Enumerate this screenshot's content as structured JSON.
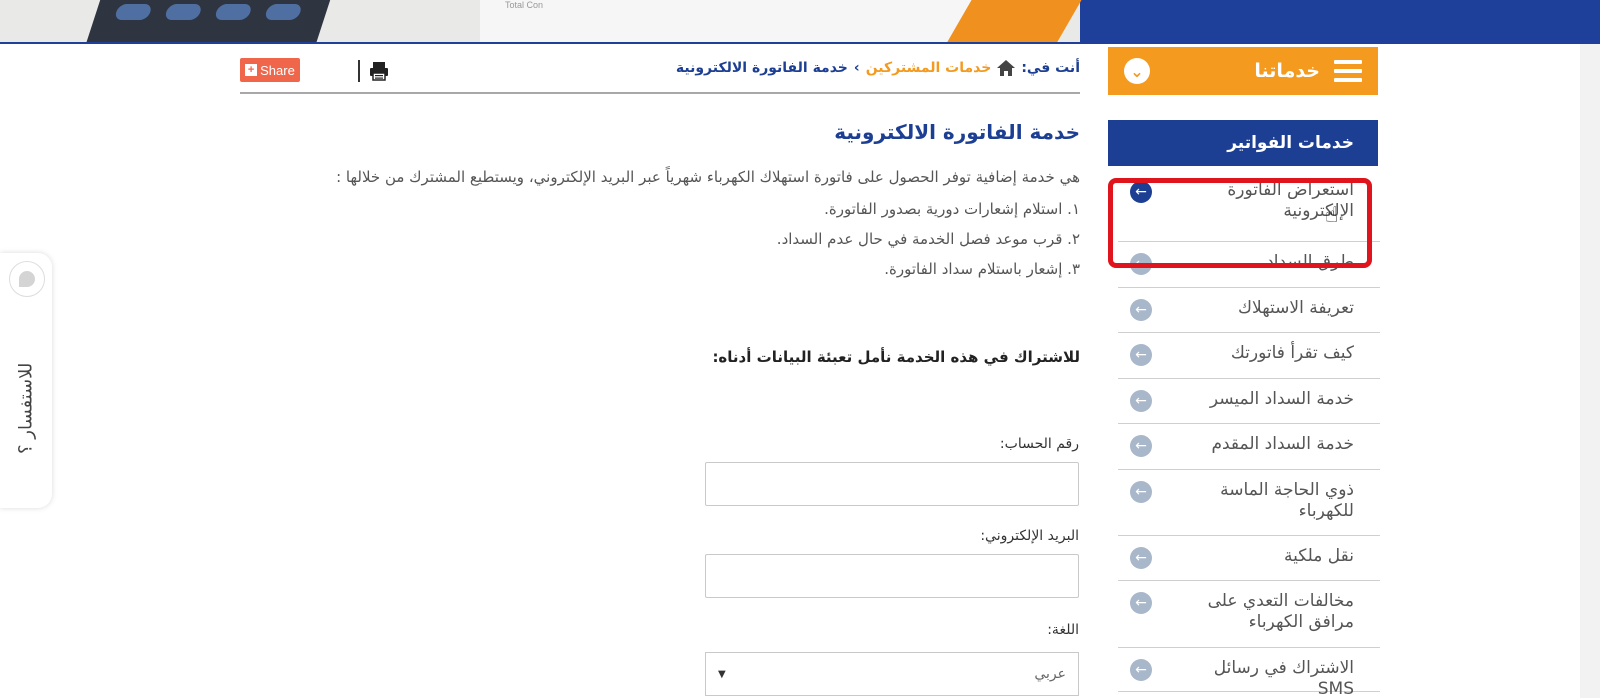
{
  "banner": {
    "paper_text": "Total Con"
  },
  "menu": {
    "label": "خدماتنا"
  },
  "sidebar": {
    "heading": "خدمات الفواتير",
    "items": [
      {
        "label": "استعراض الفاتورة الإلكترونية"
      },
      {
        "label": "طرق السداد"
      },
      {
        "label": "تعريفة الاستهلاك"
      },
      {
        "label": "كيف تقرأ فاتورتك"
      },
      {
        "label": "خدمة السداد الميسر"
      },
      {
        "label": "خدمة السداد المقدم"
      },
      {
        "label": "ذوي الحاجة الماسة للكهرباء"
      },
      {
        "label": "نقل ملكية"
      },
      {
        "label": "مخالفات التعدي على مرافق الكهرباء"
      },
      {
        "label": "الاشتراك في رسائل SMS"
      }
    ]
  },
  "breadcrumb": {
    "prefix": "أنت في:",
    "parent": "خدمات المشتركين",
    "separator": "›",
    "current": "خدمة الفاتورة الالكترونية"
  },
  "toolbar": {
    "share_label": "Share",
    "share_plus": "+"
  },
  "content": {
    "title": "خدمة الفاتورة الالكترونية",
    "description": "هي خدمة إضافية توفر الحصول على فاتورة استهلاك الكهرباء شهرياً عبر البريد الإلكتروني، ويستطيع المشترك من خلالها :",
    "points": [
      "١. استلام إشعارات دورية بصدور الفاتورة.",
      "٢. قرب موعد فصل الخدمة في حال عدم السداد.",
      "٣. إشعار باستلام سداد الفاتورة."
    ],
    "subscribe_text": "للاشتراك في هذه الخدمة  نأمل تعبئة البيانات أدناه:"
  },
  "form": {
    "account_label": "رقم الحساب:",
    "account_value": "",
    "email_label": "البريد الإلكتروني:",
    "email_value": "",
    "language_label": "اللغة:",
    "language_value": "عربي"
  },
  "feedback": {
    "label": "للاستفسار ؟"
  },
  "colors": {
    "brand_blue": "#1d3f93",
    "brand_orange": "#f39a1f",
    "highlight_red": "#e0141c"
  }
}
